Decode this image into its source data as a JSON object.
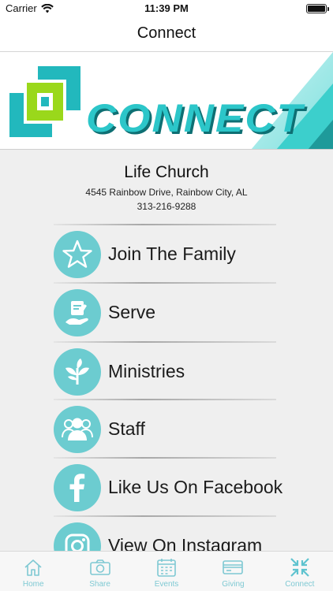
{
  "status_bar": {
    "carrier": "Carrier",
    "time": "11:39 PM"
  },
  "nav": {
    "title": "Connect"
  },
  "banner": {
    "text": "CONNECT"
  },
  "church": {
    "name": "Life Church",
    "address": "4545 Rainbow Drive, Rainbow City, AL",
    "phone": "313-216-9288"
  },
  "menu": [
    {
      "label": "Join The Family",
      "icon": "star-icon"
    },
    {
      "label": "Serve",
      "icon": "serve-hand-icon"
    },
    {
      "label": "Ministries",
      "icon": "plant-icon"
    },
    {
      "label": "Staff",
      "icon": "people-icon"
    },
    {
      "label": "Like Us On Facebook",
      "icon": "facebook-icon"
    },
    {
      "label": "View On Instagram",
      "icon": "instagram-icon"
    }
  ],
  "tabs": [
    {
      "label": "Home",
      "icon": "home-icon"
    },
    {
      "label": "Share",
      "icon": "camera-icon"
    },
    {
      "label": "Events",
      "icon": "calendar-icon"
    },
    {
      "label": "Giving",
      "icon": "card-icon"
    },
    {
      "label": "Connect",
      "icon": "connect-arrows-icon"
    }
  ],
  "colors": {
    "accent": "#6cccd0",
    "tab_label": "#7fc9d3",
    "banner_teal": "#2fc4c6",
    "banner_green": "#9ad81b"
  }
}
